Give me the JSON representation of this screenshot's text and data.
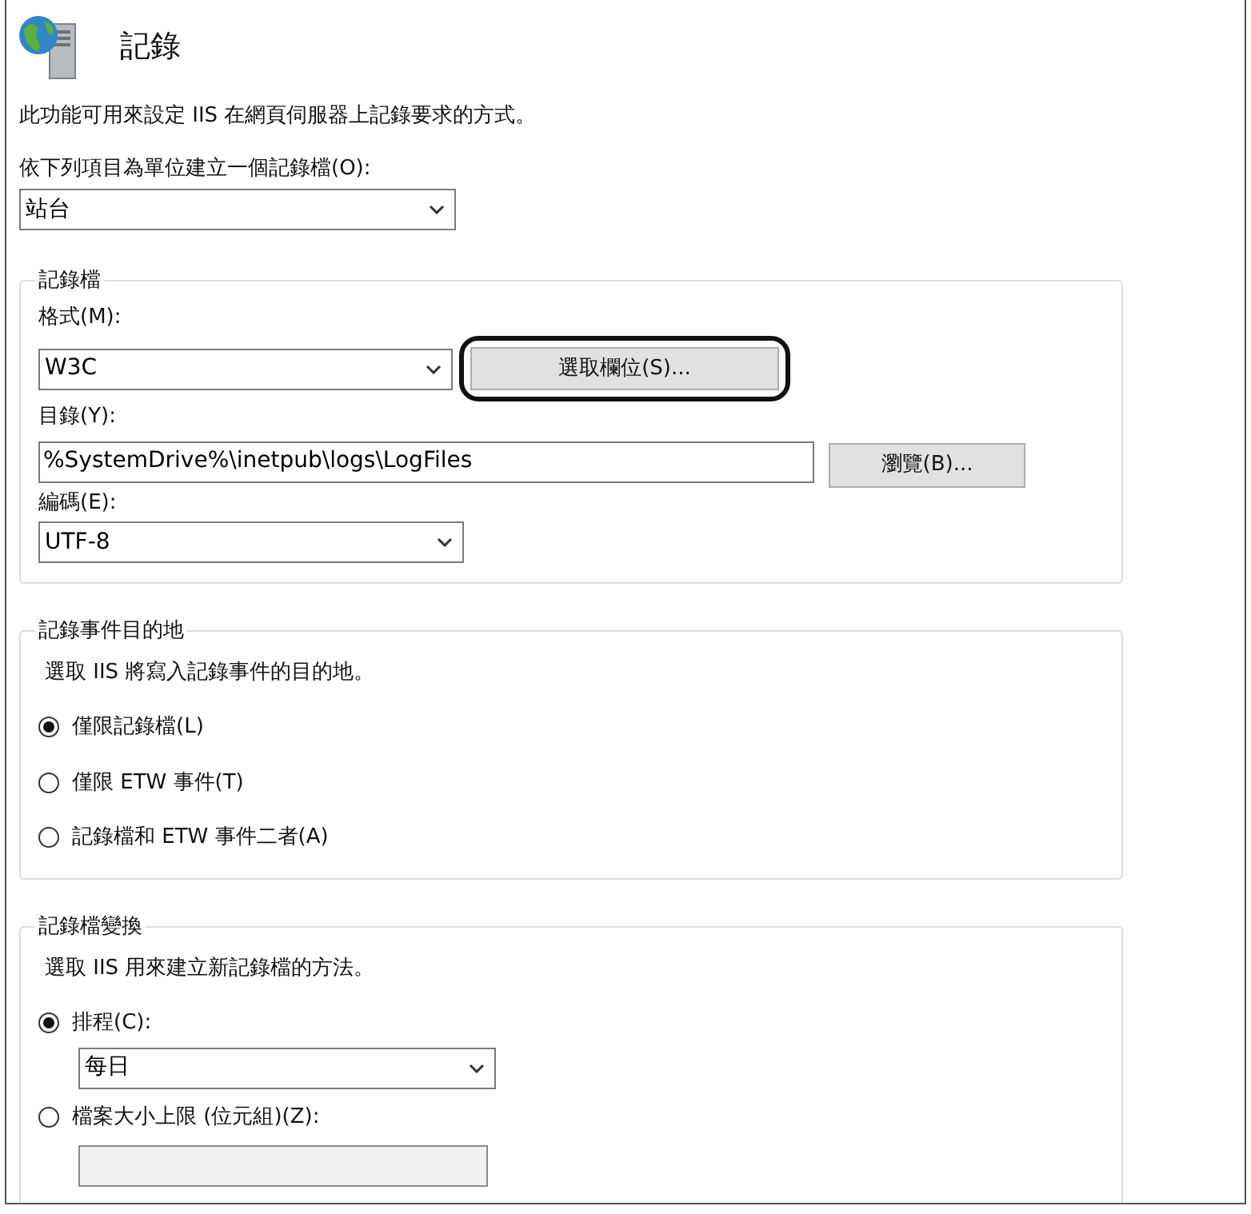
{
  "header": {
    "title": "記錄"
  },
  "description": "此功能可用來設定 IIS 在網頁伺服器上記錄要求的方式。",
  "per_unit": {
    "label": "依下列項目為單位建立一個記錄檔(O):",
    "value": "站台"
  },
  "log_file": {
    "legend": "記錄檔",
    "format": {
      "label": "格式(M):",
      "value": "W3C"
    },
    "select_fields_button": {
      "label": "選取欄位(S)...",
      "highlighted": true
    },
    "directory": {
      "label": "目錄(Y):",
      "value": "%SystemDrive%\\inetpub\\logs\\LogFiles"
    },
    "browse_button": "瀏覽(B)...",
    "encoding": {
      "label": "編碼(E):",
      "value": "UTF-8"
    }
  },
  "destination": {
    "legend": "記錄事件目的地",
    "description": "選取 IIS 將寫入記錄事件的目的地。",
    "options": [
      {
        "label": "僅限記錄檔(L)",
        "selected": true
      },
      {
        "label": "僅限 ETW 事件(T)",
        "selected": false
      },
      {
        "label": "記錄檔和 ETW 事件二者(A)",
        "selected": false
      }
    ]
  },
  "rollover": {
    "legend": "記錄檔變換",
    "description": "選取 IIS 用來建立新記錄檔的方法。",
    "options": [
      {
        "kind": "select",
        "label": "排程(C):",
        "selected": true,
        "value": "每日"
      },
      {
        "kind": "input",
        "label": "檔案大小上限 (位元組)(Z):",
        "selected": false,
        "disabled": true
      }
    ]
  }
}
